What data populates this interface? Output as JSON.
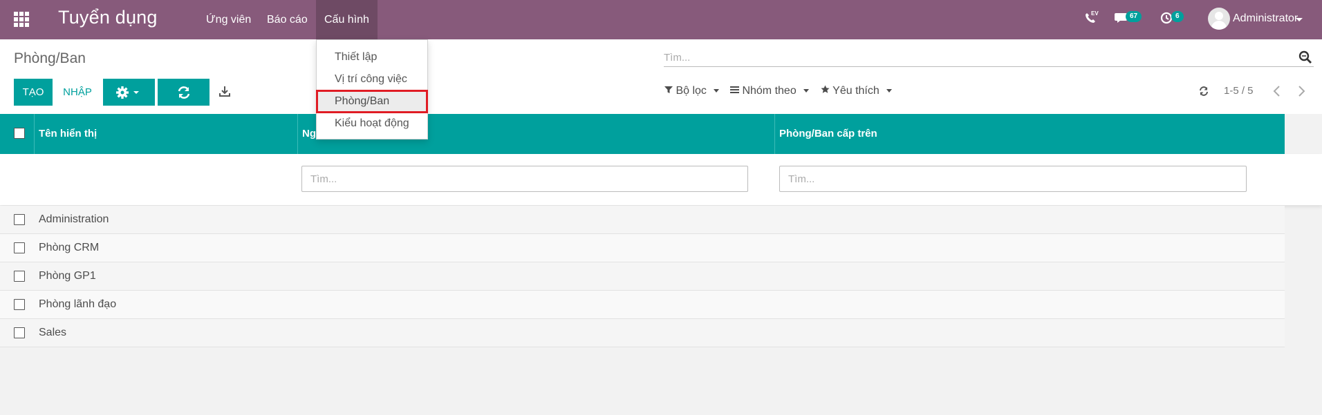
{
  "navbar": {
    "app_title": "Tuyển dụng",
    "menus": [
      "Ứng viên",
      "Báo cáo",
      "Cấu hình"
    ],
    "call_label": "EV",
    "messages_count": "67",
    "activities_count": "6",
    "user_name": "Administrator",
    "color": "#875a7b"
  },
  "dropdown": {
    "items": [
      "Thiết lập",
      "Vị trí công việc",
      "Phòng/Ban",
      "Kiểu hoạt động"
    ],
    "selected_index": 2
  },
  "control_panel": {
    "breadcrumb": "Phòng/Ban",
    "search_placeholder": "Tìm...",
    "create_label": "TẠO",
    "import_label": "NHẬP",
    "filter_label": "Bộ lọc",
    "groupby_label": "Nhóm theo",
    "favorites_label": "Yêu thích",
    "pager": "1-5 / 5"
  },
  "table": {
    "columns": [
      "Tên hiển thị",
      "Ng",
      "Phòng/Ban cấp trên"
    ],
    "filter_placeholder": "Tìm...",
    "rows": [
      "Administration",
      "Phòng CRM",
      "Phòng GP1",
      "Phòng lãnh đạo",
      "Sales"
    ],
    "header_color": "#00a09d"
  }
}
